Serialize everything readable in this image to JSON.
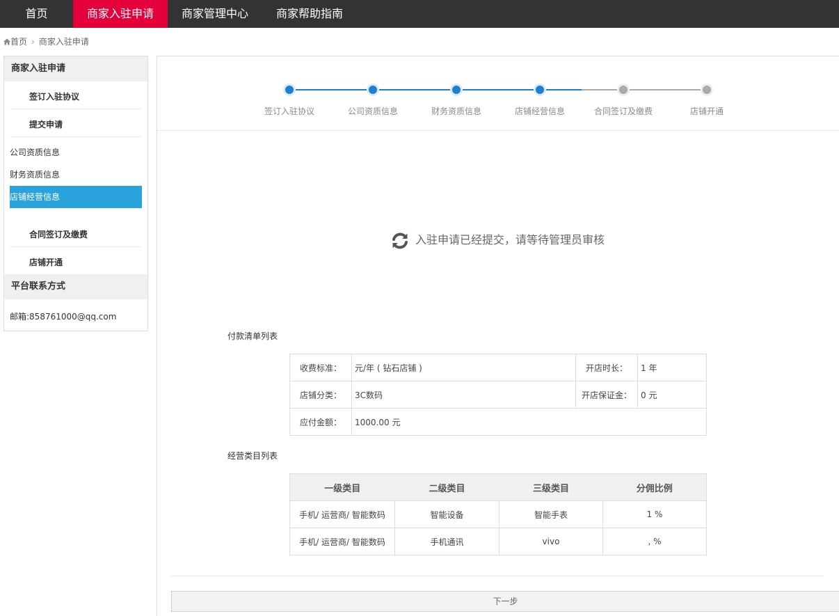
{
  "nav": {
    "items": [
      "首页",
      "商家入驻申请",
      "商家管理中心",
      "商家帮助指南"
    ],
    "active_index": 1,
    "active_color": "#e4003a",
    "bar_color": "#333333"
  },
  "breadcrumb": {
    "home": "首页",
    "current": "商家入驻申请"
  },
  "sidebar": {
    "title": "商家入驻申请",
    "steps": [
      "签订入驻协议",
      "提交申请",
      "合同签订及缴费",
      "店铺开通"
    ],
    "sub_items": [
      "公司资质信息",
      "财务资质信息",
      "店铺经营信息"
    ],
    "active_sub": "店铺经营信息",
    "contact_title": "平台联系方式",
    "email": "邮箱:858761000@qq.com",
    "active_color": "#2aa3dc"
  },
  "progress": {
    "steps": [
      "签订入驻协议",
      "公司资质信息",
      "财务资质信息",
      "店铺经营信息",
      "合同签订及缴费",
      "店铺开通"
    ],
    "completed": 4,
    "active_color": "#1e7fd0",
    "inactive_color": "#aaaaaa"
  },
  "notice": {
    "icon": "refresh-icon",
    "text": "入驻申请已经提交，请等待管理员审核"
  },
  "fee_section": {
    "title": "付款清单列表",
    "fee_standard_label": "收费标准：",
    "fee_standard_value": "元/年 ( 钻石店铺 )",
    "duration_label": "开店时长：",
    "duration_value": "1 年",
    "category_label": "店铺分类：",
    "category_value": "3C数码",
    "deposit_label": "开店保证金：",
    "deposit_value": "0 元",
    "amount_label": "应付金额：",
    "amount_value": "1000.00 元"
  },
  "category_section": {
    "title": "经营类目列表",
    "headers": [
      "一级类目",
      "二级类目",
      "三级类目",
      "分佣比例"
    ],
    "rows": [
      [
        "手机/ 运营商/ 智能数码",
        "智能设备",
        "智能手表",
        "1 %"
      ],
      [
        "手机/ 运营商/ 智能数码",
        "手机通讯",
        "vivo",
        ", %"
      ]
    ]
  },
  "next_button": "下一步"
}
